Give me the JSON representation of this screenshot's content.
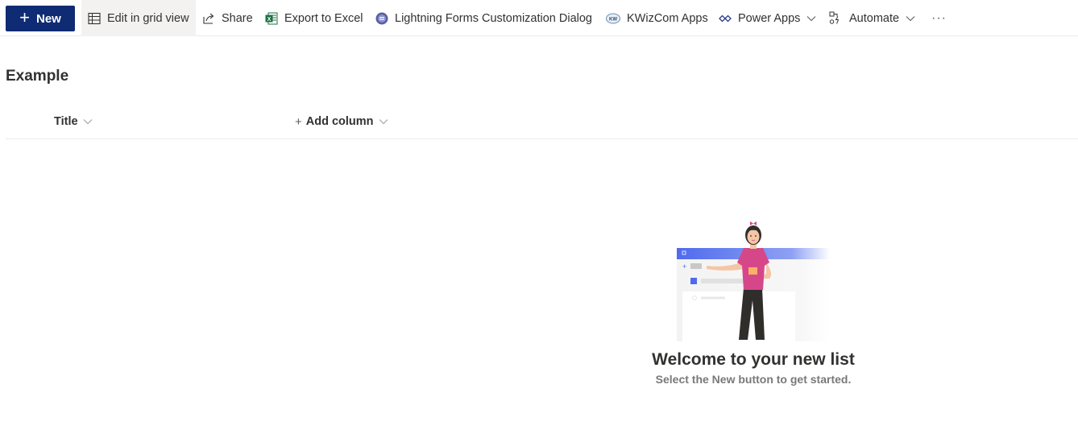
{
  "toolbar": {
    "new_label": "New",
    "items": [
      {
        "label": "Edit in grid view",
        "icon": "grid-icon"
      },
      {
        "label": "Share",
        "icon": "share-icon"
      },
      {
        "label": "Export to Excel",
        "icon": "excel-icon"
      },
      {
        "label": "Lightning Forms Customization Dialog",
        "icon": "lightning-forms-icon"
      },
      {
        "label": "KWizCom Apps",
        "icon": "kwizcom-icon"
      },
      {
        "label": "Power Apps",
        "icon": "power-apps-icon"
      },
      {
        "label": "Automate",
        "icon": "automate-icon"
      }
    ],
    "more_label": "···"
  },
  "list": {
    "title": "Example",
    "columns": [
      {
        "label": "Title"
      },
      {
        "label": "Add column"
      }
    ]
  },
  "empty_state": {
    "title": "Welcome to your new list",
    "subtitle": "Select the New button to get started."
  },
  "colors": {
    "accent": "#0f2b73",
    "excel": "#1d6f42",
    "border": "#edebe9",
    "illustration_blue": "#4f6bed",
    "shirt": "#d6478a"
  }
}
